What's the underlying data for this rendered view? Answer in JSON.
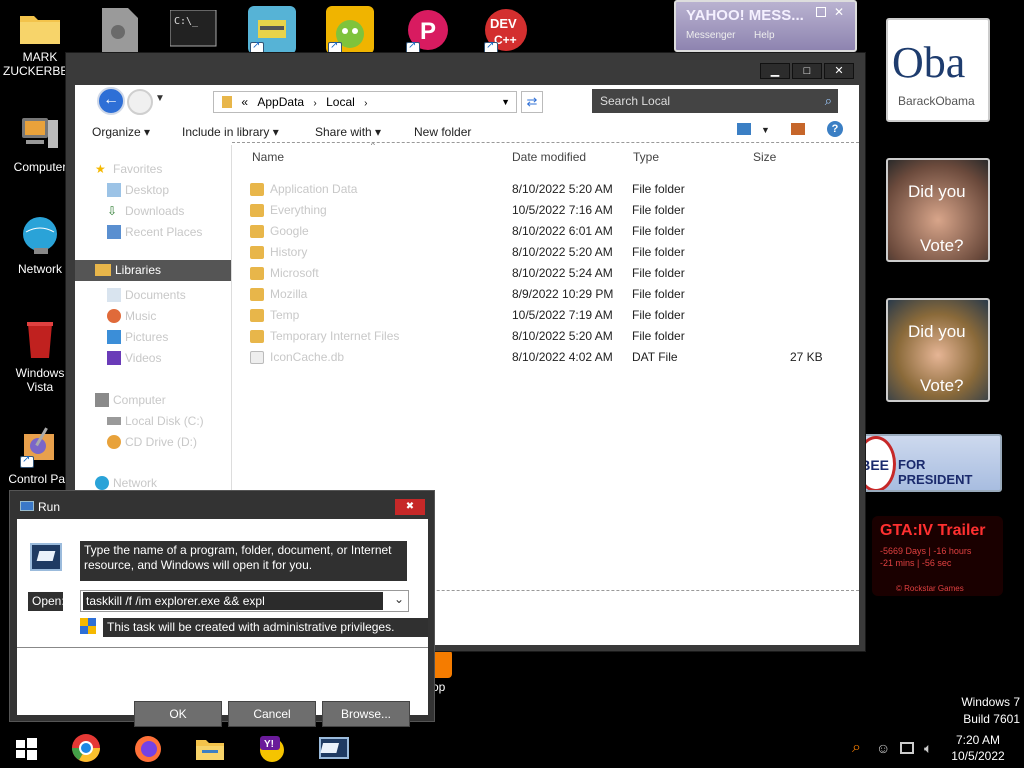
{
  "desktop": {
    "icons": [
      {
        "label": "MARK\nZUCKERBER"
      },
      {
        "label": "Computer"
      },
      {
        "label": "Network"
      },
      {
        "label": "Windows\nVista"
      },
      {
        "label": "Control Pan"
      }
    ],
    "partial_label": "op",
    "watermark": {
      "line1": "Windows 7",
      "line2": "Build 7601"
    }
  },
  "gadgets": {
    "yahoo": {
      "title": "YAHOO! MESS...",
      "sub1": "Messenger",
      "sub2": "Help"
    },
    "obama": {
      "big": "Oba",
      "small": "BarackObama"
    },
    "vote1": {
      "line1": "Did you",
      "line2": "Vote?"
    },
    "vote2": {
      "line1": "Did you",
      "line2": "Vote?"
    },
    "huckabee": {
      "left": "BEE",
      "right": "FOR PRESIDENT"
    },
    "gta": {
      "title": "GTA:IV  Trailer",
      "line1": "-5669 Days | -16 hours",
      "line2": "-21 mins | -56 sec",
      "footer": "© Rockstar Games"
    }
  },
  "explorer": {
    "address": {
      "prefix": "«",
      "crumbs": [
        "AppData",
        "Local"
      ]
    },
    "search_placeholder": "Search Local",
    "toolbar": {
      "organize": "Organize ▾",
      "include": "Include in library ▾",
      "share": "Share with ▾",
      "newfolder": "New folder"
    },
    "columns": {
      "name": "Name",
      "date": "Date modified",
      "type": "Type",
      "size": "Size"
    },
    "nav": {
      "favorites": "Favorites",
      "desktop": "Desktop",
      "downloads": "Downloads",
      "recent": "Recent Places",
      "libraries": "Libraries",
      "documents": "Documents",
      "music": "Music",
      "pictures": "Pictures",
      "videos": "Videos",
      "computer": "Computer",
      "localdisk": "Local Disk (C:)",
      "cddrive": "CD Drive (D:)",
      "network": "Network"
    },
    "files": [
      {
        "name": "Application Data",
        "date": "8/10/2022 5:20 AM",
        "type": "File folder",
        "size": ""
      },
      {
        "name": "Everything",
        "date": "10/5/2022 7:16 AM",
        "type": "File folder",
        "size": ""
      },
      {
        "name": "Google",
        "date": "8/10/2022 6:01 AM",
        "type": "File folder",
        "size": ""
      },
      {
        "name": "History",
        "date": "8/10/2022 5:20 AM",
        "type": "File folder",
        "size": ""
      },
      {
        "name": "Microsoft",
        "date": "8/10/2022 5:24 AM",
        "type": "File folder",
        "size": ""
      },
      {
        "name": "Mozilla",
        "date": "8/9/2022 10:29 PM",
        "type": "File folder",
        "size": ""
      },
      {
        "name": "Temp",
        "date": "10/5/2022 7:19 AM",
        "type": "File folder",
        "size": ""
      },
      {
        "name": "Temporary Internet Files",
        "date": "8/10/2022 5:20 AM",
        "type": "File folder",
        "size": ""
      },
      {
        "name": "IconCache.db",
        "date": "8/10/2022 4:02 AM",
        "type": "DAT File",
        "size": "27 KB"
      }
    ]
  },
  "run": {
    "title": "Run",
    "close": "✖",
    "description": "Type the name of a program, folder, document, or Internet resource, and Windows will open it for you.",
    "open_label": "Open:",
    "command": "taskkill /f /im explorer.exe && expl",
    "admin_note": "This task will be created with administrative privileges.",
    "ok": "OK",
    "cancel": "Cancel",
    "browse": "Browse..."
  },
  "taskbar": {
    "time": "7:20 AM",
    "date": "10/5/2022"
  }
}
